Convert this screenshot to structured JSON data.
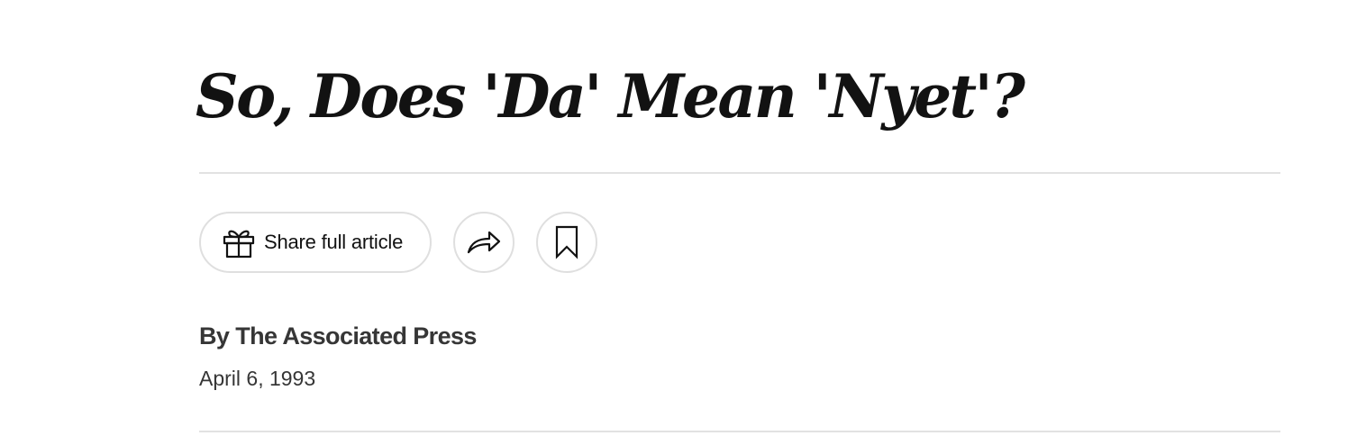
{
  "article": {
    "headline": "So, Does 'Da' Mean 'Nyet'?",
    "byline": "By The Associated Press",
    "date": "April 6, 1993"
  },
  "share_bar": {
    "gift_label": "Share full article",
    "gift_icon": "gift-icon",
    "share_icon": "share-arrow-icon",
    "save_icon": "bookmark-icon"
  },
  "colors": {
    "text": "#121212",
    "byline_text": "#363636",
    "rule": "#e2e2e2",
    "button_border": "#dfdfdf"
  }
}
